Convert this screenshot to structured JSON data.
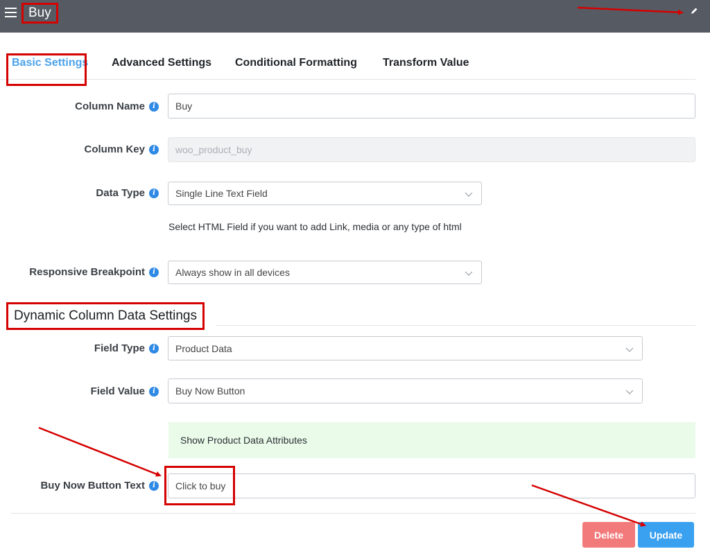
{
  "header": {
    "title": "Buy",
    "menu_icon": "hamburger-menu-icon",
    "edit_icon": "pencil-icon",
    "background": "#565b63"
  },
  "tabs": [
    {
      "label": "Basic Settings",
      "active": true
    },
    {
      "label": "Advanced Settings",
      "active": false
    },
    {
      "label": "Conditional Formatting",
      "active": false
    },
    {
      "label": "Transform Value",
      "active": false
    }
  ],
  "form": {
    "column_name": {
      "label": "Column Name",
      "value": "Buy"
    },
    "column_key": {
      "label": "Column Key",
      "value": "woo_product_buy"
    },
    "data_type": {
      "label": "Data Type",
      "value": "Single Line Text Field",
      "help": "Select HTML Field if you want to add Link, media or any type of html"
    },
    "responsive_breakpoint": {
      "label": "Responsive Breakpoint",
      "value": "Always show in all devices"
    }
  },
  "dynamic_section": {
    "title": "Dynamic Column Data Settings",
    "field_type": {
      "label": "Field Type",
      "value": "Product Data"
    },
    "field_value": {
      "label": "Field Value",
      "value": "Buy Now Button"
    },
    "attributes_link": "Show Product Data Attributes",
    "buy_now_text": {
      "label": "Buy Now Button Text",
      "value": "Click to buy"
    }
  },
  "actions": {
    "delete_label": "Delete",
    "update_label": "Update"
  },
  "colors": {
    "accent": "#4aa3ec",
    "annotation": "#d50000",
    "delete": "#f37a7b",
    "update": "#3aa0f0",
    "info": "#2f8ae5"
  }
}
